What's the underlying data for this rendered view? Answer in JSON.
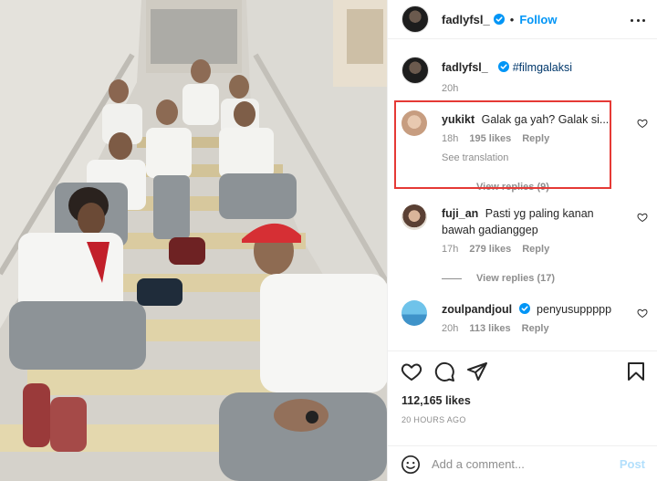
{
  "post": {
    "author": "fadlyfsl_",
    "follow_label": "Follow",
    "separator": "•",
    "caption_author": "fadlyfsl_",
    "caption_text": "#filmgalaksi",
    "caption_time": "20h",
    "likes": "112,165 likes",
    "time_ago": "20 HOURS AGO",
    "add_comment_placeholder": "Add a comment...",
    "post_label": "Post"
  },
  "comments": [
    {
      "username": "yukikt",
      "text": "Galak ga yah? Galak si....",
      "time": "18h",
      "likes": "195 likes",
      "reply_label": "Reply",
      "see_translation": "See translation",
      "view_replies": "View replies (9)"
    },
    {
      "username": "fuji_an",
      "text": "Pasti yg paling kanan bawah gadianggep",
      "time": "17h",
      "likes": "279 likes",
      "reply_label": "Reply",
      "view_replies": "View replies (17)"
    },
    {
      "username": "zoulpandjoul",
      "text": "penyusuppppp",
      "time": "20h",
      "likes": "113 likes",
      "reply_label": "Reply"
    }
  ],
  "colors": {
    "accent": "#0095f6",
    "highlight": "#e53935",
    "muted": "#8e8e8e"
  },
  "icons": [
    "verified-icon",
    "more-icon",
    "heart-icon",
    "comment-icon",
    "share-icon",
    "bookmark-icon",
    "emoji-icon"
  ]
}
